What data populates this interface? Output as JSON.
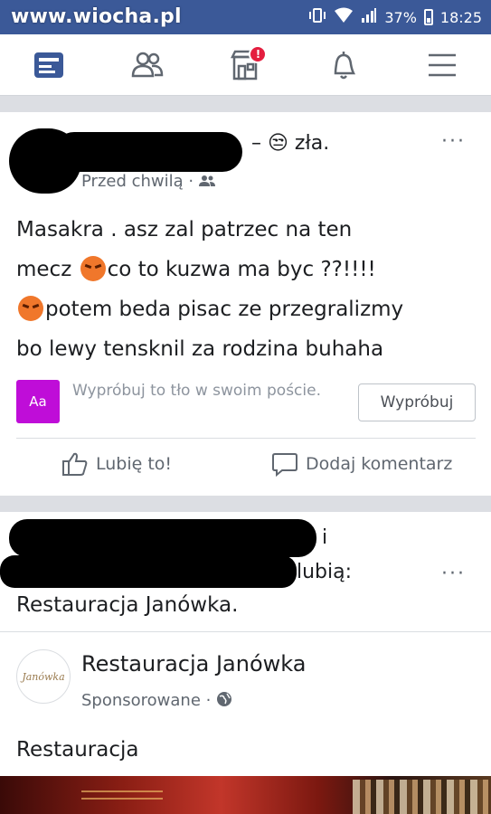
{
  "statusbar": {
    "watermark": "www.wiocha.pl",
    "battery": "37%",
    "time": "18:25"
  },
  "navbar": {
    "items": [
      {
        "name": "news-feed",
        "icon": "news-feed-icon"
      },
      {
        "name": "friends",
        "icon": "friends-icon"
      },
      {
        "name": "marketplace",
        "icon": "marketplace-icon",
        "badge": "!"
      },
      {
        "name": "notifications",
        "icon": "bell-icon"
      },
      {
        "name": "menu",
        "icon": "hamburger-icon"
      }
    ],
    "active_color": "#3b5998"
  },
  "post1": {
    "feeling": "– 😒 zła.",
    "timestamp": "Przed chwilą ·",
    "text_line1": "Masakra . asz zal patrzec na ten",
    "text_line2a": "mecz ",
    "text_line2b": "co to kuzwa ma byc ??!!!!",
    "text_line3": "potem beda pisac ze przegralizmy",
    "text_line4": "bo lewy tensknil za rodzina buhaha",
    "try_icon_label": "Aa",
    "try_text": "Wypróbuj to tło w swoim poście.",
    "try_button": "Wypróbuj",
    "like_label": "Lubię to!",
    "comment_label": "Dodaj komentarz",
    "more": "···"
  },
  "post2": {
    "context_i": "i",
    "context_like": "lubią:",
    "context_page": "Restauracja Janówka.",
    "page_name": "Restauracja Janówka",
    "sponsored": "Sponsorowane ·",
    "body": "Restauracja",
    "logo_text": "Janówka",
    "more": "···"
  }
}
